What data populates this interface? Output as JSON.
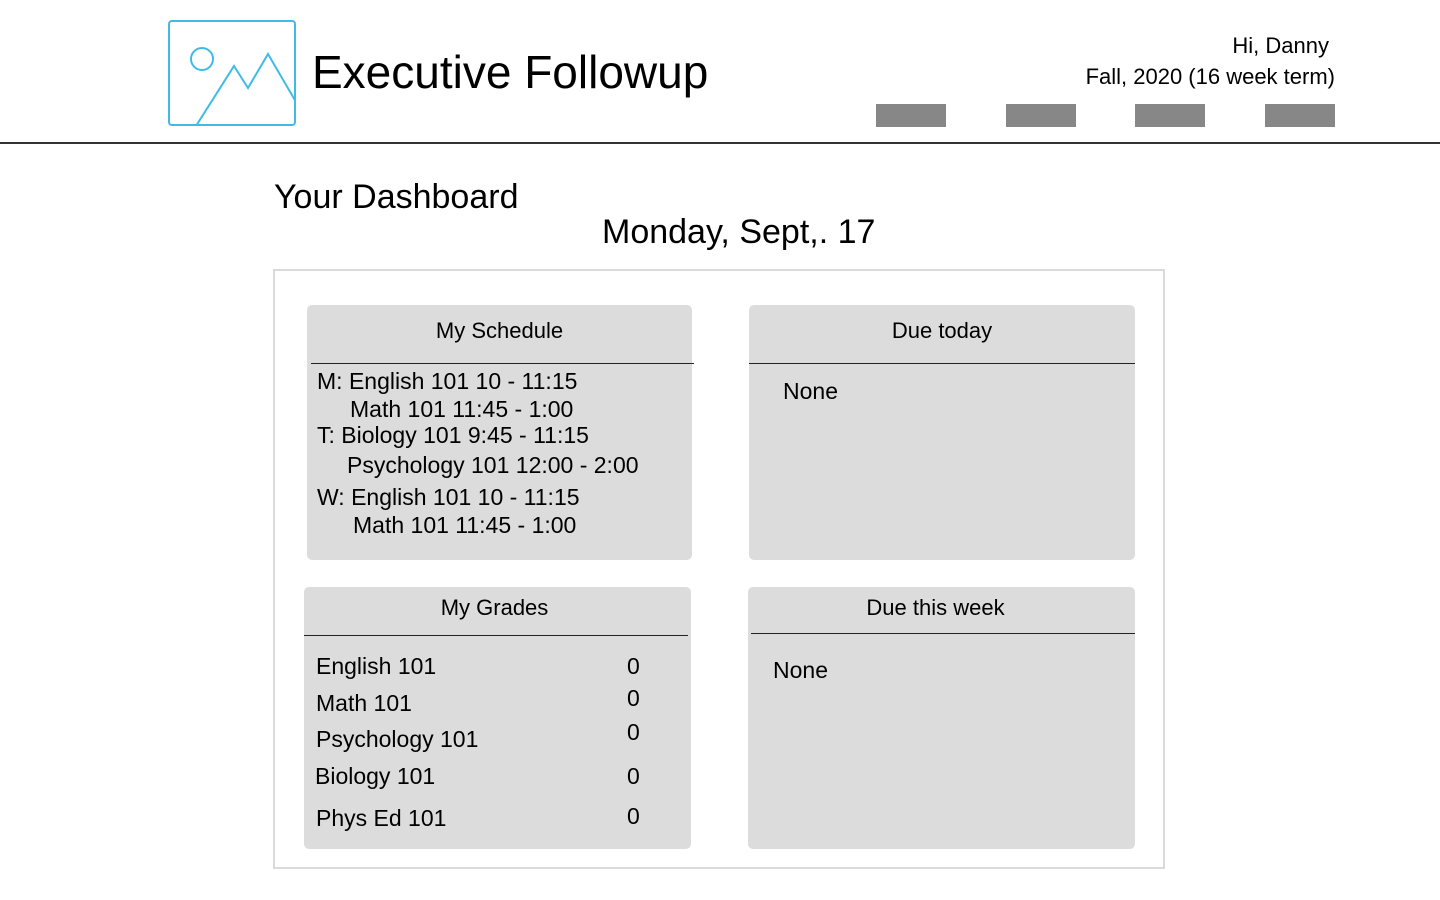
{
  "header": {
    "logo_icon": "image-placeholder-icon",
    "app_title": "Executive Followup",
    "greeting": "Hi, Danny",
    "term": "Fall, 2020 (16 week term)",
    "nav_button_color": "#878787"
  },
  "dashboard": {
    "title": "Your Dashboard",
    "date": "Monday, Sept,. 17"
  },
  "schedule": {
    "title": "My Schedule",
    "lines": [
      "M: English 101 10 - 11:15",
      "Math 101 11:45 - 1:00",
      "T: Biology 101 9:45 - 11:15",
      "Psychology 101 12:00 - 2:00",
      "W: English 101 10 - 11:15",
      "Math 101 11:45 - 1:00"
    ]
  },
  "due_today": {
    "title": "Due today",
    "text": "None"
  },
  "grades": {
    "title": "My Grades",
    "rows": [
      {
        "course": "English 101",
        "grade": "0"
      },
      {
        "course": "Math 101",
        "grade": "0"
      },
      {
        "course": "Psychology 101",
        "grade": "0"
      },
      {
        "course": "Biology 101",
        "grade": "0"
      },
      {
        "course": "Phys Ed 101",
        "grade": "0"
      }
    ]
  },
  "due_this_week": {
    "title": "Due this week",
    "text": "None"
  },
  "colors": {
    "logo_accent": "#3fbbe8",
    "card_background": "#dcdcdc"
  }
}
